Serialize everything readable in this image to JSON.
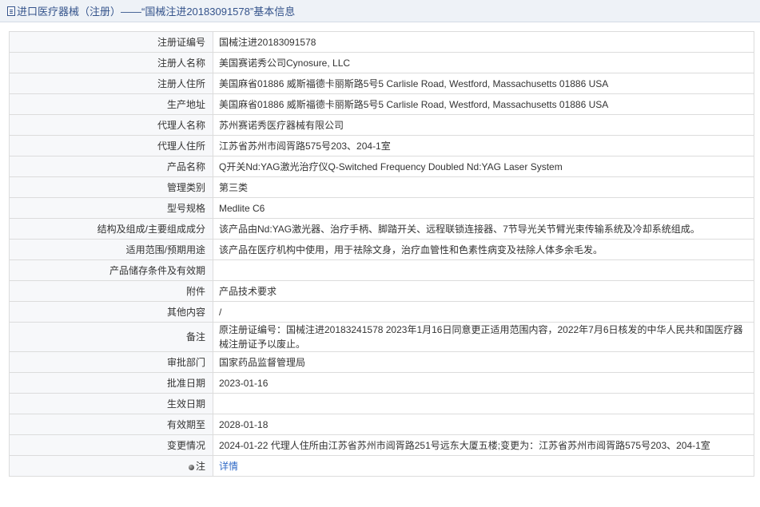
{
  "header": {
    "title": "进口医疗器械（注册）——“国械注进20183091578”基本信息"
  },
  "details": {
    "rows": [
      {
        "label": "注册证编号",
        "value": "国械注进20183091578"
      },
      {
        "label": "注册人名称",
        "value": "美国赛诺秀公司Cynosure, LLC"
      },
      {
        "label": "注册人住所",
        "value": "美国麻省01886 威斯福德卡丽斯路5号5 Carlisle Road, Westford, Massachusetts 01886 USA"
      },
      {
        "label": "生产地址",
        "value": "美国麻省01886 威斯福德卡丽斯路5号5 Carlisle Road, Westford, Massachusetts 01886 USA"
      },
      {
        "label": "代理人名称",
        "value": "苏州赛诺秀医疗器械有限公司"
      },
      {
        "label": "代理人住所",
        "value": "江苏省苏州市阊胥路575号203、204-1室"
      },
      {
        "label": "产品名称",
        "value": "Q开关Nd:YAG激光治疗仪Q-Switched Frequency Doubled Nd:YAG Laser System"
      },
      {
        "label": "管理类别",
        "value": "第三类"
      },
      {
        "label": "型号规格",
        "value": "Medlite C6"
      },
      {
        "label": "结构及组成/主要组成成分",
        "value": "该产品由Nd:YAG激光器、治疗手柄、脚踏开关、远程联锁连接器、7节导光关节臂光束传输系统及冷却系统组成。"
      },
      {
        "label": "适用范围/预期用途",
        "value": "该产品在医疗机构中使用，用于祛除文身，治疗血管性和色素性病变及祛除人体多余毛发。"
      },
      {
        "label": "产品储存条件及有效期",
        "value": ""
      },
      {
        "label": "附件",
        "value": "产品技术要求"
      },
      {
        "label": "其他内容",
        "value": "/"
      },
      {
        "label": "备注",
        "value": "原注册证编号：国械注进20183241578 2023年1月16日同意更正适用范围内容，2022年7月6日核发的中华人民共和国医疗器械注册证予以废止。"
      },
      {
        "label": "审批部门",
        "value": "国家药品监督管理局"
      },
      {
        "label": "批准日期",
        "value": "2023-01-16"
      },
      {
        "label": "生效日期",
        "value": ""
      },
      {
        "label": "有效期至",
        "value": "2028-01-18"
      },
      {
        "label": "变更情况",
        "value": "2024-01-22 代理人住所由江苏省苏州市阊胥路251号远东大厦五楼;变更为：江苏省苏州市阊胥路575号203、204-1室"
      }
    ],
    "note": {
      "label": "注",
      "link_text": "详情",
      "icon": "note-bullet-icon"
    }
  }
}
